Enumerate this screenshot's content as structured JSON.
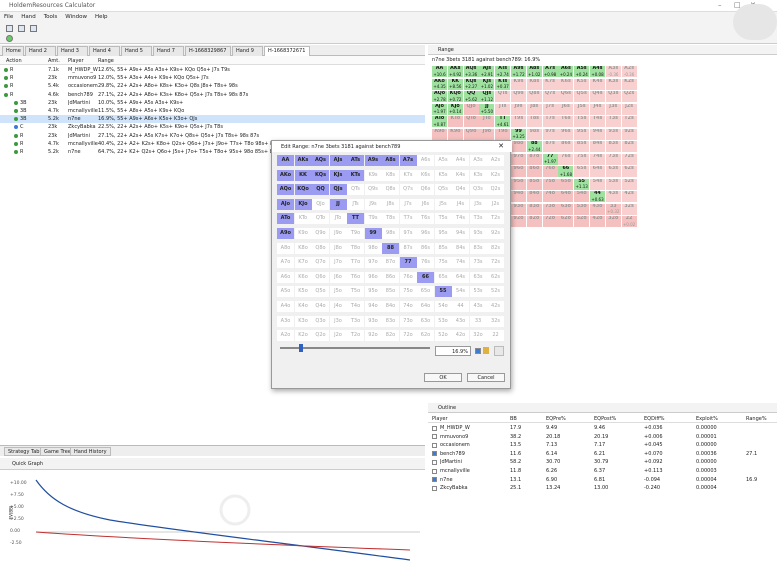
{
  "app": {
    "title": "HoldemResources Calculator"
  },
  "menu": [
    "File",
    "Hand",
    "Tools",
    "Window",
    "Help"
  ],
  "tabs": [
    "Home",
    "Hand 2",
    "Hand 3",
    "Hand 4",
    "Hand 5",
    "Hand 7",
    "H-1668329867",
    "Hand 9",
    "H-1668372671"
  ],
  "table": {
    "headers": [
      "Action",
      "Amt.",
      "Player",
      "Range"
    ],
    "rows": [
      {
        "action": "R",
        "amt": "7.1k",
        "player": "M_HWDP_W",
        "range": "12.6%, 55+ A9s+ A5s A3s+ K9s+ KQo Q5s+ J7s T9s"
      },
      {
        "action": "R",
        "amt": "23k",
        "player": "mmuvono9",
        "range": "12.0%, 55+ A3s+ A4s+ K9s+ KQo Q5s+ J7s"
      },
      {
        "action": "R",
        "amt": "5.4k",
        "player": "occasionem",
        "range": "29.8%, 22+ A2s+ A8o+ K8s+ K3o+ Q8s J8s+ T8s+ 98s"
      },
      {
        "action": "R",
        "amt": "4.6k",
        "player": "bench789",
        "range": "27.1%, 22+ A2s+ A8o+ K3s+ K8o+ Q5s+ J7s T8s+ 98s 87s"
      },
      {
        "action": "3B",
        "amt": "23k",
        "player": "JdMartini",
        "range": "10.0%, 55+ A9s+ A5s A3s+ K9s+"
      },
      {
        "action": "3B",
        "amt": "4.7k",
        "player": "mcnallyville",
        "range": "11.5%, 55+ A8s+ A5s+ K9s+ KQo"
      },
      {
        "action": "3B",
        "amt": "5.2k",
        "player": "n7ne",
        "range": "16.9%, 55+ A9s+ A6s+ K5s+ K3o+ QJs"
      },
      {
        "action": "C",
        "amt": "23k",
        "player": "ZkcyBabka",
        "range": "22.5%, 22+ A2s+ A8o+ K5s+ K9o+ Q5s+ J7s T8s"
      },
      {
        "action": "R",
        "amt": "23k",
        "player": "JdMartini",
        "range": "27.1%, 22+ A2s+ A5s K7s+ K7o+ Q8s+ Q5s+ J7s T8s+ 98s 87s"
      },
      {
        "action": "R",
        "amt": "4.7k",
        "player": "mcnallyville",
        "range": "40.4%, 22+ A2+ K2s+ K8o+ Q2s+ Q6o+ J7s+ J9o+ T7s+ T8o 98s+ 86s+ 75s+ 64s+"
      },
      {
        "action": "R",
        "amt": "5.2k",
        "player": "n7ne",
        "range": "64.7%, 22+ K2+ Q2s+ Q6o+ J5s+ J7o+ T5s+ T8o+ 95s+ 98o 85s+ 87o 75s+ 64s+ 53s+"
      }
    ]
  },
  "bottom_tabs": [
    "Strategy Table",
    "Game Tree",
    "Hand History"
  ],
  "quick_graph": {
    "title": "Quick Graph",
    "y_ticks": [
      "+10.00",
      "+7.50",
      "+5.00",
      "+2.50",
      "0.00",
      "-2.50"
    ],
    "y_label": "EV(BB)"
  },
  "range_panel": {
    "title": "Range",
    "subtitle": "n7ne 3bets 3181 against bench789: 16.9%"
  },
  "hand_labels": [
    [
      "AA",
      "AKs",
      "AQs",
      "AJs",
      "ATs",
      "A9s",
      "A8s",
      "A7s",
      "A6s",
      "A5s",
      "A4s",
      "A3s",
      "A2s"
    ],
    [
      "AKo",
      "KK",
      "KQs",
      "KJs",
      "KTs",
      "K9s",
      "K8s",
      "K7s",
      "K6s",
      "K5s",
      "K4s",
      "K3s",
      "K2s"
    ],
    [
      "AQo",
      "KQo",
      "QQ",
      "QJs",
      "QTs",
      "Q9s",
      "Q8s",
      "Q7s",
      "Q6s",
      "Q5s",
      "Q4s",
      "Q3s",
      "Q2s"
    ],
    [
      "AJo",
      "KJo",
      "QJo",
      "JJ",
      "JTs",
      "J9s",
      "J8s",
      "J7s",
      "J6s",
      "J5s",
      "J4s",
      "J3s",
      "J2s"
    ],
    [
      "ATo",
      "KTo",
      "QTo",
      "JTo",
      "TT",
      "T9s",
      "T8s",
      "T7s",
      "T6s",
      "T5s",
      "T4s",
      "T3s",
      "T2s"
    ],
    [
      "A9o",
      "K9o",
      "Q9o",
      "J9o",
      "T9o",
      "99",
      "98s",
      "97s",
      "96s",
      "95s",
      "94s",
      "93s",
      "92s"
    ],
    [
      "A8o",
      "K8o",
      "Q8o",
      "J8o",
      "T8o",
      "98o",
      "88",
      "87s",
      "86s",
      "85s",
      "84s",
      "83s",
      "82s"
    ],
    [
      "A7o",
      "K7o",
      "Q7o",
      "J7o",
      "T7o",
      "97o",
      "87o",
      "77",
      "76s",
      "75s",
      "74s",
      "73s",
      "72s"
    ],
    [
      "A6o",
      "K6o",
      "Q6o",
      "J6o",
      "T6o",
      "96o",
      "86o",
      "76o",
      "66",
      "65s",
      "64s",
      "63s",
      "62s"
    ],
    [
      "A5o",
      "K5o",
      "Q5o",
      "J5o",
      "T5o",
      "95o",
      "85o",
      "75o",
      "65o",
      "55",
      "54s",
      "53s",
      "52s"
    ],
    [
      "A4o",
      "K4o",
      "Q4o",
      "J4o",
      "T4o",
      "94o",
      "84o",
      "74o",
      "64o",
      "54o",
      "44",
      "43s",
      "42s"
    ],
    [
      "A3o",
      "K3o",
      "Q3o",
      "J3o",
      "T3o",
      "93o",
      "83o",
      "73o",
      "63o",
      "53o",
      "43o",
      "33",
      "32s"
    ],
    [
      "A2o",
      "K2o",
      "Q2o",
      "J2o",
      "T2o",
      "92o",
      "82o",
      "72o",
      "62o",
      "52o",
      "42o",
      "32o",
      "22"
    ]
  ],
  "range_values": {
    "AA": "+10.6",
    "AKs": "+4.92",
    "AQs": "+3.36",
    "AJs": "+2.91",
    "ATs": "+2.74",
    "A9s": "+1.72",
    "A8s": "+1.02",
    "A7s": "+0.98",
    "A6s": "+0.24",
    "A5s": "+0.24",
    "A4s": "+0.08",
    "A3s": "-0.36",
    "A2s": "-0.36",
    "AKo": "+4.35",
    "KK": "+8.56",
    "KQs": "+2.27",
    "KJs": "+1.02",
    "KTs": "+0.37",
    "AQo": "+2.78",
    "KQo": "+0.72",
    "QQ": "+5.62",
    "QJs": "+1.12",
    "AJo": "+1.97",
    "KJo": "+0.14",
    "JJ": "+5.50",
    "ATo": "+0.87",
    "TT": "+4.61",
    "99": "+3.25",
    "88": "+2.44",
    "77": "+1.97",
    "66": "+1.68",
    "55": "+1.13",
    "44": "+0.63",
    "33": "+0.32",
    "22": "+0.02"
  },
  "dialog": {
    "title": "Edit Range: n7ne 3bets 3181 against bench789",
    "percent": "16.9%",
    "ok": "OK",
    "cancel": "Cancel"
  },
  "outline": {
    "title": "Outline",
    "headers": [
      "Player",
      "BB",
      "EQPre%",
      "EQPost%",
      "EQDiff%",
      "Exploit%",
      "Range%"
    ],
    "rows": [
      {
        "player": "M_HWDP_W",
        "bb": "17.9",
        "eqpre": "9.49",
        "eqpost": "9.46",
        "diff": "+0.036",
        "exp": "0.00000",
        "range": "",
        "checked": false
      },
      {
        "player": "mmuvono9",
        "bb": "38.2",
        "eqpre": "20.18",
        "eqpost": "20.19",
        "diff": "+0.006",
        "exp": "0.00001",
        "range": "",
        "checked": false
      },
      {
        "player": "occasionem",
        "bb": "13.5",
        "eqpre": "7.13",
        "eqpost": "7.17",
        "diff": "+0.045",
        "exp": "0.00000",
        "range": "",
        "checked": false
      },
      {
        "player": "bench789",
        "bb": "11.6",
        "eqpre": "6.14",
        "eqpost": "6.21",
        "diff": "+0.070",
        "exp": "0.00036",
        "range": "27.1",
        "checked": true
      },
      {
        "player": "JdMartini",
        "bb": "58.2",
        "eqpre": "30.70",
        "eqpost": "30.79",
        "diff": "+0.092",
        "exp": "0.00000",
        "range": "",
        "checked": false
      },
      {
        "player": "mcnallyville",
        "bb": "11.8",
        "eqpre": "6.26",
        "eqpost": "6.37",
        "diff": "+0.113",
        "exp": "0.00003",
        "range": "",
        "checked": false
      },
      {
        "player": "n7ne",
        "bb": "13.1",
        "eqpre": "6.90",
        "eqpost": "6.81",
        "diff": "-0.094",
        "exp": "0.00004",
        "range": "16.9",
        "checked": true
      },
      {
        "player": "ZkcyBabka",
        "bb": "25.1",
        "eqpre": "13.24",
        "eqpost": "13.00",
        "diff": "-0.240",
        "exp": "0.00004",
        "range": "",
        "checked": false
      }
    ]
  },
  "colors": {
    "selected": "#9b9bf2",
    "positive": "#9fe29f",
    "negative": "#f5b0b0",
    "accent": "#3a7bd5"
  }
}
